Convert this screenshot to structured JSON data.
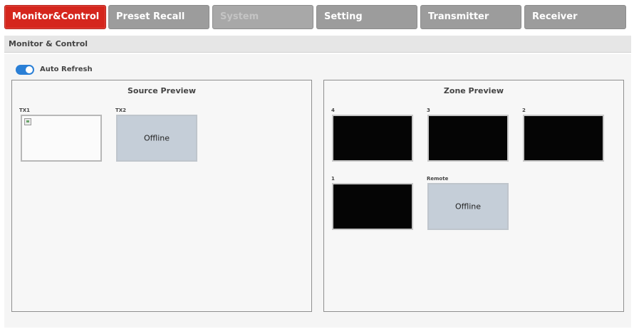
{
  "tabs": [
    {
      "label": "Monitor&Control",
      "state": "active"
    },
    {
      "label": "Preset Recall",
      "state": "normal"
    },
    {
      "label": "System",
      "state": "disabled"
    },
    {
      "label": "Setting",
      "state": "normal"
    },
    {
      "label": "Transmitter",
      "state": "normal"
    },
    {
      "label": "Receiver",
      "state": "normal"
    }
  ],
  "section": {
    "title": "Monitor & Control"
  },
  "auto_refresh": {
    "label": "Auto Refresh",
    "enabled": true
  },
  "source_preview": {
    "title": "Source Preview",
    "items": [
      {
        "label": "TX1",
        "status": "image"
      },
      {
        "label": "TX2",
        "status": "offline",
        "text": "Offline"
      }
    ]
  },
  "zone_preview": {
    "title": "Zone Preview",
    "items": [
      {
        "label": "4",
        "status": "black"
      },
      {
        "label": "3",
        "status": "black"
      },
      {
        "label": "2",
        "status": "black"
      },
      {
        "label": "1",
        "status": "black"
      },
      {
        "label": "Remote",
        "status": "offline",
        "text": "Offline"
      }
    ]
  },
  "colors": {
    "active_tab": "#d5261d",
    "tab": "#9c9c9c",
    "toggle_on": "#2a7fd6",
    "offline_tile": "#c5ced8"
  }
}
